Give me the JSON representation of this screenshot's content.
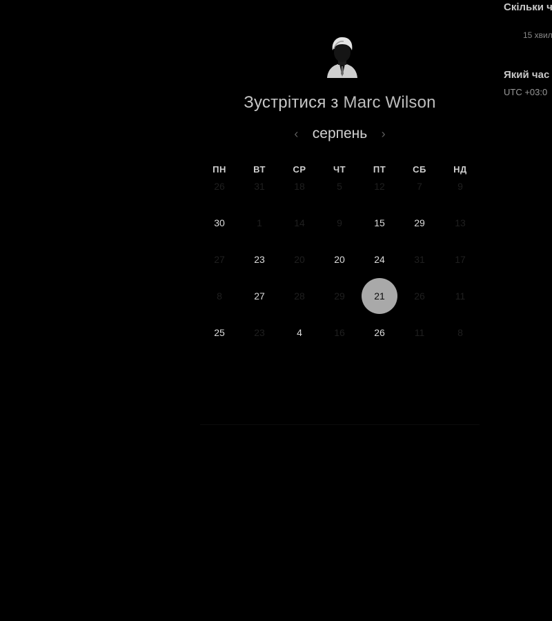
{
  "scheduler": {
    "heading_prefix": "Зустрітися з",
    "host_name": "Marc Wilson",
    "avatar": "person-avatar",
    "month": "серпень",
    "prev_icon": "chevron-left-icon",
    "next_icon": "chevron-right-icon",
    "weekdays": [
      "ПН",
      "ВТ",
      "СР",
      "ЧТ",
      "ПТ",
      "СБ",
      "НД"
    ],
    "weeks": [
      [
        {
          "d": "26",
          "s": "off"
        },
        {
          "d": "31",
          "s": "off"
        },
        {
          "d": "18",
          "s": "off"
        },
        {
          "d": "5",
          "s": "off"
        },
        {
          "d": "12",
          "s": "off"
        },
        {
          "d": "7",
          "s": "off"
        },
        {
          "d": "9",
          "s": "off"
        }
      ],
      [
        {
          "d": "30",
          "s": "on"
        },
        {
          "d": "1",
          "s": "off"
        },
        {
          "d": "14",
          "s": "off"
        },
        {
          "d": "9",
          "s": "off"
        },
        {
          "d": "15",
          "s": "on"
        },
        {
          "d": "29",
          "s": "on"
        },
        {
          "d": "13",
          "s": "off"
        }
      ],
      [
        {
          "d": "27",
          "s": "off"
        },
        {
          "d": "23",
          "s": "on"
        },
        {
          "d": "20",
          "s": "off"
        },
        {
          "d": "20",
          "s": "on"
        },
        {
          "d": "24",
          "s": "on"
        },
        {
          "d": "31",
          "s": "off"
        },
        {
          "d": "17",
          "s": "off"
        }
      ],
      [
        {
          "d": "8",
          "s": "off"
        },
        {
          "d": "27",
          "s": "on"
        },
        {
          "d": "28",
          "s": "off"
        },
        {
          "d": "29",
          "s": "off"
        },
        {
          "d": "21",
          "s": "selected"
        },
        {
          "d": "26",
          "s": "off"
        },
        {
          "d": "11",
          "s": "off"
        }
      ],
      [
        {
          "d": "25",
          "s": "on"
        },
        {
          "d": "23",
          "s": "off"
        },
        {
          "d": "4",
          "s": "on"
        },
        {
          "d": "16",
          "s": "off"
        },
        {
          "d": "26",
          "s": "on"
        },
        {
          "d": "11",
          "s": "off"
        },
        {
          "d": "8",
          "s": "off"
        }
      ]
    ],
    "colors": {
      "background": "#000000",
      "selected_day": "#a9a9a9",
      "available_day_text": "#dcdcdc",
      "unavailable_day_text": "#1f1f1f"
    }
  },
  "sidepanel": {
    "duration_title": "Скільки ч",
    "duration_value": "15 хвил",
    "time_title": "Який час",
    "timezone": "UTC +03:0"
  }
}
